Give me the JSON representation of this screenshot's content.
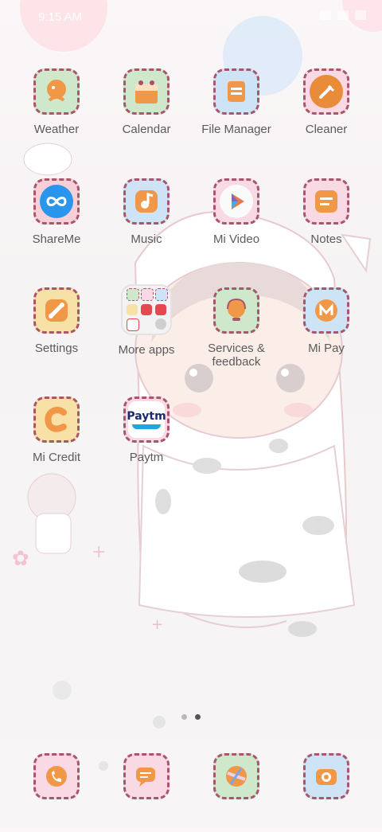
{
  "status": {
    "time": "9:15 AM"
  },
  "apps": [
    {
      "label": "Weather",
      "icon": "weather-icon",
      "bg": "#cfe8cc"
    },
    {
      "label": "Calendar",
      "icon": "calendar-icon",
      "bg": "#cfe8cc"
    },
    {
      "label": "File Manager",
      "icon": "file-manager-icon",
      "bg": "#cfe3f6"
    },
    {
      "label": "Cleaner",
      "icon": "cleaner-icon",
      "bg": "#f8d9e4"
    },
    {
      "label": "ShareMe",
      "icon": "shareme-icon",
      "bg": "#f7cfd9"
    },
    {
      "label": "Music",
      "icon": "music-icon",
      "bg": "#cfe3f6"
    },
    {
      "label": "Mi Video",
      "icon": "mi-video-icon",
      "bg": "#f8d9e4"
    },
    {
      "label": "Notes",
      "icon": "notes-icon",
      "bg": "#f8d9e4"
    },
    {
      "label": "Settings",
      "icon": "settings-icon",
      "bg": "#f7e1a6"
    },
    {
      "label": "More apps",
      "icon": "folder-icon",
      "bg": "#f3f3f3"
    },
    {
      "label": "Services & feedback",
      "icon": "services-feedback-icon",
      "bg": "#cfe8cc"
    },
    {
      "label": "Mi Pay",
      "icon": "mi-pay-icon",
      "bg": "#cfe3f6"
    },
    {
      "label": "Mi Credit",
      "icon": "mi-credit-icon",
      "bg": "#f7e1a6"
    },
    {
      "label": "Paytm",
      "icon": "paytm-icon",
      "bg": "#f8d9e4",
      "logo_text": "Paytm"
    }
  ],
  "dock": [
    {
      "icon": "phone-icon",
      "bg": "#f8d9e4"
    },
    {
      "icon": "messages-icon",
      "bg": "#f8d9e4"
    },
    {
      "icon": "browser-icon",
      "bg": "#cfe8cc"
    },
    {
      "icon": "camera-icon",
      "bg": "#cfe3f6"
    }
  ],
  "page_indicator": {
    "count": 2,
    "active": 2
  },
  "colors": {
    "accent_dash": "#a8566a",
    "orange": "#e98c3a"
  }
}
